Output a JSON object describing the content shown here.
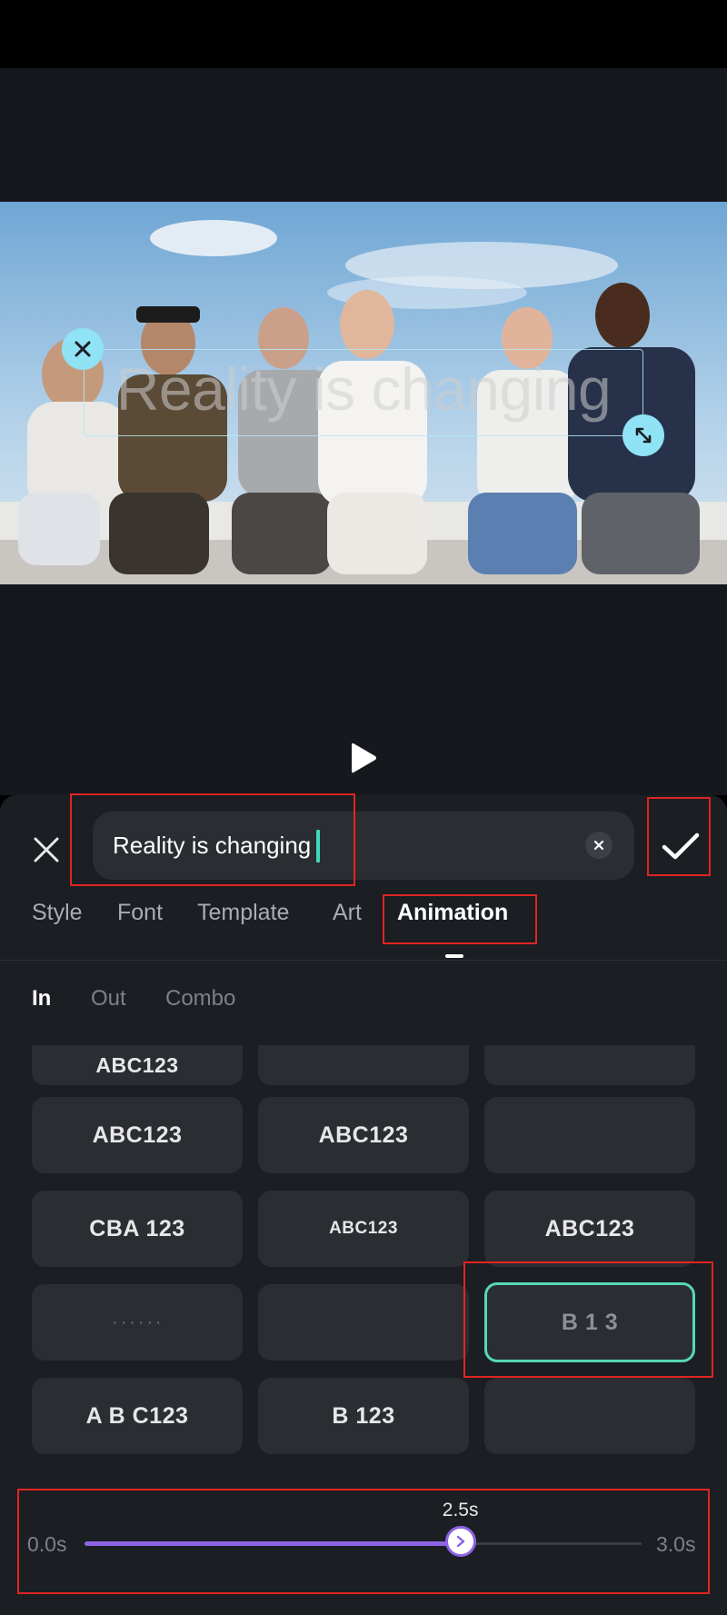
{
  "text_editor": {
    "overlay_text": "Reality is changing",
    "input_value": "Reality is changing"
  },
  "tabs": [
    {
      "label": "Style",
      "active": false
    },
    {
      "label": "Font",
      "active": false
    },
    {
      "label": "Template",
      "active": false
    },
    {
      "label": "Art",
      "active": false
    },
    {
      "label": "Animation",
      "active": true
    }
  ],
  "subtabs": [
    {
      "label": "In",
      "active": true
    },
    {
      "label": "Out",
      "active": false
    },
    {
      "label": "Combo",
      "active": false
    }
  ],
  "animation_presets": [
    [
      "ABC123",
      "",
      ""
    ],
    [
      "ABC123",
      "ABC123",
      ""
    ],
    [
      "CBA 123",
      "ABC123",
      "ABC123"
    ],
    [
      "· · · · · ·",
      "",
      "B  1  3"
    ],
    [
      "A B C123",
      "B  123",
      ""
    ]
  ],
  "selected_preset": "B  1  3",
  "duration": {
    "min_label": "0.0s",
    "max_label": "3.0s",
    "current_label": "2.5s",
    "value": 2.5,
    "max": 3.0
  },
  "colors": {
    "accent_teal": "#56d8b6",
    "slider_purple": "#8d63e6",
    "handle_blue": "#8fe3f5",
    "annotation_red": "#e02424"
  },
  "icons": {
    "close": "close-icon",
    "clear": "clear-icon",
    "confirm": "checkmark-icon",
    "play": "play-icon",
    "delete_handle": "close-icon",
    "resize_handle": "resize-icon"
  }
}
